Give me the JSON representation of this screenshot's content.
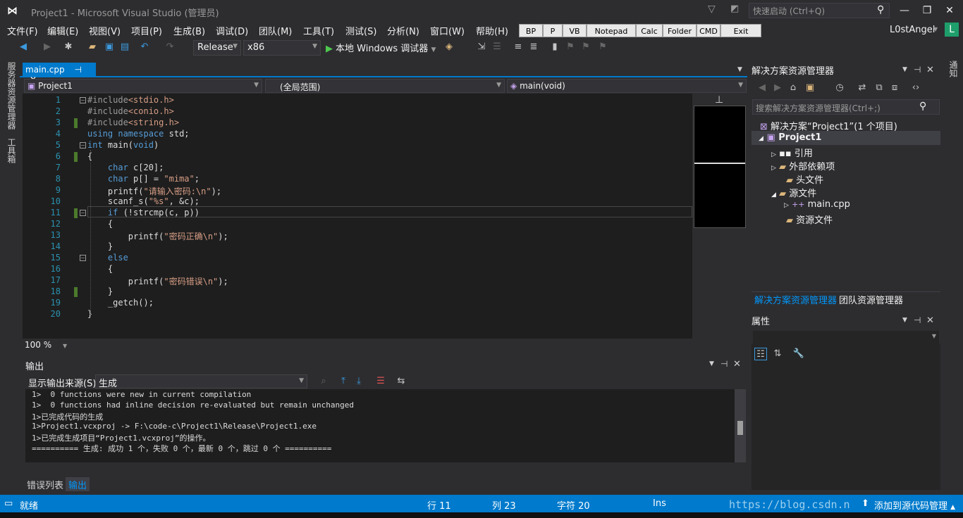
{
  "window": {
    "title": "Project1 - Microsoft Visual Studio (管理员)",
    "quick_launch": "快速启动 (Ctrl+Q)",
    "min": "—",
    "max": "❐",
    "close": "✕"
  },
  "menu": [
    "文件(F)",
    "编辑(E)",
    "视图(V)",
    "项目(P)",
    "生成(B)",
    "调试(D)",
    "团队(M)",
    "工具(T)",
    "测试(S)",
    "分析(N)",
    "窗口(W)",
    "帮助(H)"
  ],
  "tool_buttons": [
    "BP",
    "P",
    "VB",
    "Notepad",
    "Calc",
    "Folder",
    "CMD",
    "Exit"
  ],
  "user": {
    "name": "L0stAngel",
    "avatar": "L"
  },
  "toolbar": {
    "config": "Release",
    "platform": "x86",
    "run": "本地 Windows 调试器"
  },
  "left_tabs": [
    "服务器资源管理器",
    "工具箱"
  ],
  "editor": {
    "tab": "main.cpp",
    "pin": "⊣",
    "close": "✕",
    "nav_project": "Project1",
    "nav_scope": "(全局范围)",
    "nav_func": "main(void)",
    "zoom": "100 %",
    "lines": [
      {
        "n": "1",
        "t": "#include<stdio.h>"
      },
      {
        "n": "2",
        "t": "#include<conio.h>"
      },
      {
        "n": "3",
        "t": "#include<string.h>"
      },
      {
        "n": "4",
        "t": "using namespace std;"
      },
      {
        "n": "5",
        "t": "int main(void)"
      },
      {
        "n": "6",
        "t": "{"
      },
      {
        "n": "7",
        "t": "    char c[20];"
      },
      {
        "n": "8",
        "t": "    char p[] = \"mima\";"
      },
      {
        "n": "9",
        "t": "    printf(\"请输入密码:\\n\");"
      },
      {
        "n": "10",
        "t": "    scanf_s(\"%s\", &c);"
      },
      {
        "n": "11",
        "t": "    if (!strcmp(c, p))"
      },
      {
        "n": "12",
        "t": "    {"
      },
      {
        "n": "13",
        "t": "        printf(\"密码正确\\n\");"
      },
      {
        "n": "14",
        "t": "    }"
      },
      {
        "n": "15",
        "t": "    else"
      },
      {
        "n": "16",
        "t": "    {"
      },
      {
        "n": "17",
        "t": "        printf(\"密码错误\\n\");"
      },
      {
        "n": "18",
        "t": "    }"
      },
      {
        "n": "19",
        "t": "    _getch();"
      },
      {
        "n": "20",
        "t": "}"
      }
    ]
  },
  "output": {
    "title": "输出",
    "source_label": "显示输出来源(S):",
    "source": "生成",
    "lines": [
      "1>  0 functions were new in current compilation",
      "1>  0 functions had inline decision re-evaluated but remain unchanged",
      "1>已完成代码的生成",
      "1>Project1.vcxproj -> F:\\code-c\\Project1\\Release\\Project1.exe",
      "1>已完成生成项目“Project1.vcxproj”的操作。",
      "========== 生成: 成功 1 个，失败 0 个，最新 0 个，跳过 0 个 =========="
    ]
  },
  "bottom_tabs": [
    "错误列表",
    "输出"
  ],
  "solution": {
    "title": "解决方案资源管理器",
    "search": "搜索解决方案资源管理器(Ctrl+;)",
    "root": "解决方案“Project1”(1 个项目)",
    "project": "Project1",
    "items": [
      "引用",
      "外部依赖项",
      "头文件",
      "源文件",
      "main.cpp",
      "资源文件"
    ],
    "tab1": "解决方案资源管理器",
    "tab2": "团队资源管理器"
  },
  "properties": {
    "title": "属性"
  },
  "right_edge": "通知",
  "status": {
    "ready": "就绪",
    "line": "行 11",
    "col": "列 23",
    "ch": "字符 20",
    "ins": "Ins",
    "watermark": "https://blog.csdn.n",
    "source_control": "添加到源代码管理"
  }
}
